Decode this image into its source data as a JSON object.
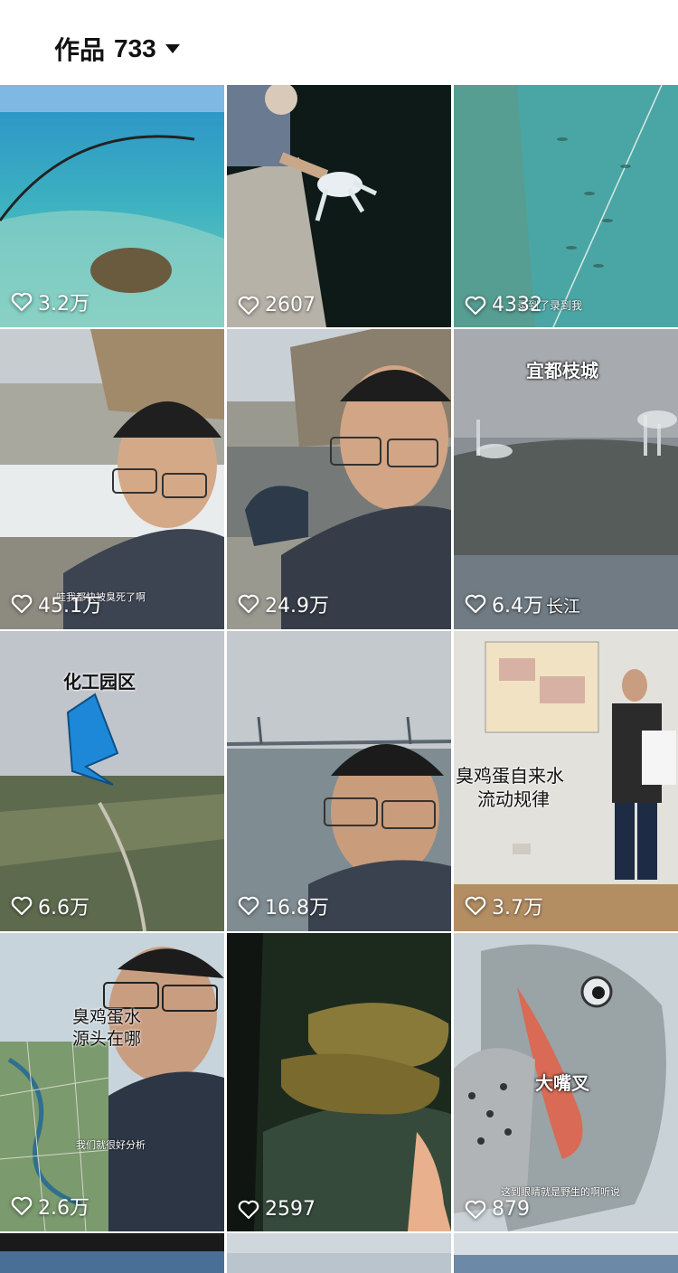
{
  "header": {
    "label": "作品",
    "count": "733"
  },
  "videos": [
    {
      "likes": "3.2万"
    },
    {
      "likes": "2607"
    },
    {
      "likes": "4332",
      "subtitle": "录到了录到我"
    },
    {
      "likes": "45.1万",
      "subtitle": "哇我都快被臭死了啊"
    },
    {
      "likes": "24.9万"
    },
    {
      "likes": "6.4万",
      "caption": "宜都枝城",
      "caption2": "长江"
    },
    {
      "likes": "6.6万",
      "caption": "化工园区"
    },
    {
      "likes": "16.8万"
    },
    {
      "likes": "3.7万",
      "caption": "臭鸡蛋自来水",
      "caption2": "流动规律"
    },
    {
      "likes": "2.6万",
      "caption": "臭鸡蛋水",
      "caption2": "源头在哪",
      "subtitle": "我们就很好分析"
    },
    {
      "likes": "2597"
    },
    {
      "likes": "879",
      "caption": "大嘴叉",
      "subtitle": "这到眼睛就是野生的啊听说"
    }
  ]
}
